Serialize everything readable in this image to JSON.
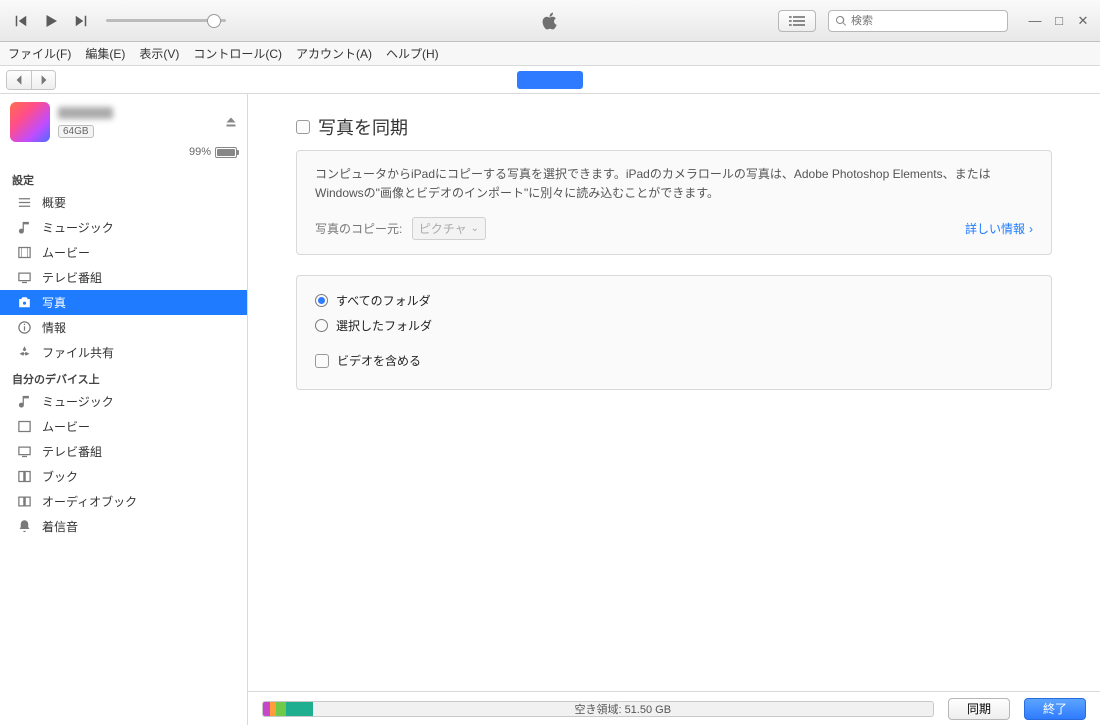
{
  "menu": {
    "file": "ファイル(F)",
    "edit": "編集(E)",
    "view": "表示(V)",
    "control": "コントロール(C)",
    "account": "アカウント(A)",
    "help": "ヘルプ(H)"
  },
  "search": {
    "placeholder": "検索"
  },
  "device": {
    "capacity_badge": "64GB",
    "battery_pct": "99%"
  },
  "sidebar": {
    "section_settings": "設定",
    "settings_items": [
      "概要",
      "ミュージック",
      "ムービー",
      "テレビ番組",
      "写真",
      "情報",
      "ファイル共有"
    ],
    "section_on_device": "自分のデバイス上",
    "on_device_items": [
      "ミュージック",
      "ムービー",
      "テレビ番組",
      "ブック",
      "オーディオブック",
      "着信音"
    ]
  },
  "main": {
    "sync_title": "写真を同期",
    "desc": "コンピュータからiPadにコピーする写真を選択できます。iPadのカメラロールの写真は、Adobe Photoshop Elements、またはWindowsの\"画像とビデオのインポート\"に別々に読み込むことができます。",
    "copy_from_label": "写真のコピー元:",
    "copy_from_value": "ピクチャ",
    "more_link": "詳しい情報",
    "opt_all_folders": "すべてのフォルダ",
    "opt_selected_folders": "選択したフォルダ",
    "opt_include_video": "ビデオを含める"
  },
  "footer": {
    "free_space": "空き領域: 51.50 GB",
    "sync_btn": "同期",
    "done_btn": "終了"
  }
}
